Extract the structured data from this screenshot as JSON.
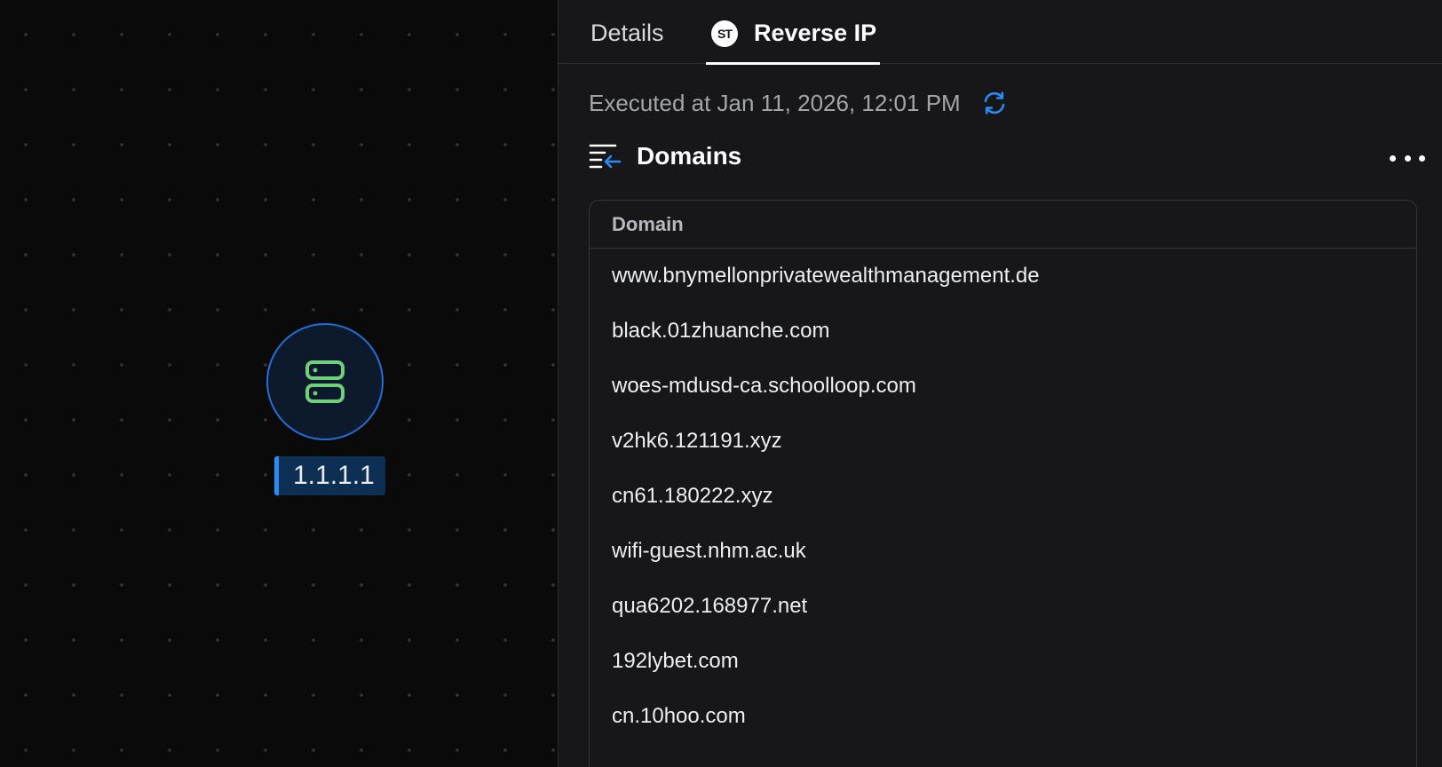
{
  "canvas": {
    "node": {
      "icon": "server-icon",
      "label": "1.1.1.1",
      "colors": {
        "ring": "#1f6fd6",
        "icon": "#6fd07c",
        "label_bg": "#0e2f54",
        "label_accent": "#2b8cf3"
      }
    }
  },
  "panel": {
    "tabs": [
      {
        "label": "Details",
        "active": false
      },
      {
        "label": "Reverse IP",
        "active": true,
        "icon": "st-logo-icon",
        "icon_text": "ST"
      }
    ],
    "executed": {
      "text": "Executed at Jan 11, 2026, 12:01 PM",
      "icon": "refresh-icon",
      "icon_color": "#2b8cf3"
    },
    "section": {
      "title": "Domains",
      "icon": "collapse-list-icon",
      "menu_icon": "more-horizontal-icon"
    },
    "table": {
      "header": "Domain",
      "rows": [
        "www.bnymellonprivatewealthmanagement.de",
        "black.01zhuanche.com",
        "woes-mdusd-ca.schoolloop.com",
        "v2hk6.121191.xyz",
        "cn61.180222.xyz",
        "wifi-guest.nhm.ac.uk",
        "qua6202.168977.net",
        "192lybet.com",
        "cn.10hoo.com"
      ]
    }
  }
}
